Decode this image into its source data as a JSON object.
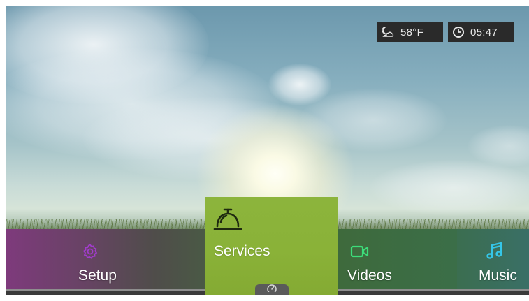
{
  "status_bar": {
    "weather": {
      "icon": "night-cloud-icon",
      "temperature": "58°F"
    },
    "clock": {
      "icon": "clock-icon",
      "time": "05:47"
    }
  },
  "menu": {
    "items": [
      {
        "label": "Setup",
        "icon": "gear-icon",
        "accent": "#9b35c4"
      },
      {
        "label": "Services",
        "icon": "service-bell-icon",
        "selected": true
      },
      {
        "label": "Videos",
        "icon": "video-camera-icon",
        "accent": "#3ddc7a"
      },
      {
        "label": "Music",
        "icon": "music-note-icon",
        "accent": "#35c6e8"
      }
    ]
  },
  "dashboard_tab": {
    "icon": "gauge-icon"
  }
}
